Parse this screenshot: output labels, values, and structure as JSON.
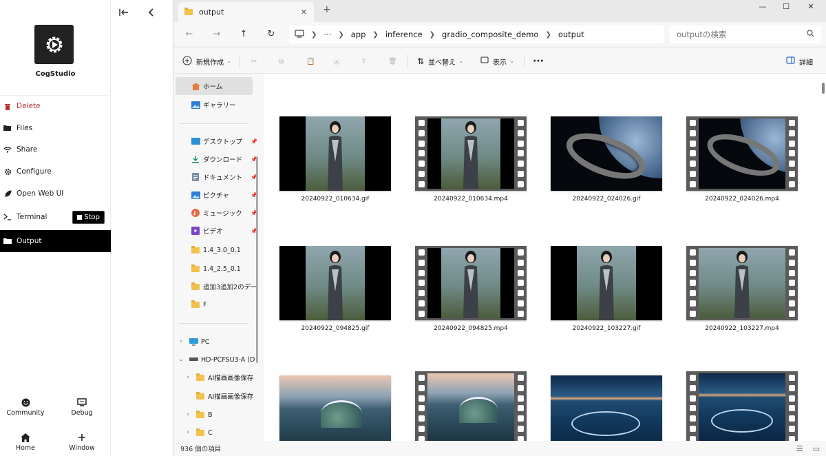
{
  "cogstudio": {
    "app_name": "CogStudio",
    "menu": [
      {
        "label": "Delete",
        "icon": "trash-icon"
      },
      {
        "label": "Files",
        "icon": "folder-open-icon"
      },
      {
        "label": "Share",
        "icon": "wifi-icon"
      },
      {
        "label": "Configure",
        "icon": "gear-icon"
      },
      {
        "label": "Open Web UI",
        "icon": "rocket-icon"
      },
      {
        "label": "Terminal",
        "icon": "terminal-icon"
      },
      {
        "label": "Output",
        "icon": "folder-icon"
      }
    ],
    "stop_label": "Stop",
    "active_item": "Output",
    "footer": [
      {
        "label": "Community",
        "icon": "smile-icon"
      },
      {
        "label": "Debug",
        "icon": "monitor-icon"
      },
      {
        "label": "Home",
        "icon": "home-icon"
      },
      {
        "label": "Window",
        "icon": "plus-icon"
      }
    ]
  },
  "explorer": {
    "tab_title": "output",
    "breadcrumb": [
      "app",
      "inference",
      "gradio_composite_demo",
      "output"
    ],
    "search_placeholder": "outputの検索",
    "toolbar": {
      "new_label": "新規作成",
      "sort_label": "並べ替え",
      "view_label": "表示",
      "details_label": "詳細"
    },
    "nav": {
      "home": "ホーム",
      "gallery": "ギャラリー",
      "pinned": [
        {
          "label": "デスクトップ",
          "icon": "desktop-icon"
        },
        {
          "label": "ダウンロード",
          "icon": "download-icon"
        },
        {
          "label": "ドキュメント",
          "icon": "document-icon"
        },
        {
          "label": "ピクチャ",
          "icon": "pictures-icon"
        },
        {
          "label": "ミュージック",
          "icon": "music-icon"
        },
        {
          "label": "ビデオ",
          "icon": "video-icon"
        }
      ],
      "folders": [
        "1.4_3.0_0.1",
        "1.4_2.5_0.1",
        "追加3追加2のデー",
        "F"
      ],
      "pc": "PC",
      "drive": "HD-PCFSU3-A (D",
      "drive_children": [
        "AI描画画像保存",
        "AI描画画像保存",
        "B",
        "C"
      ]
    },
    "files": [
      "20240922_010634.gif",
      "20240922_010634.mp4",
      "20240922_024026.gif",
      "20240922_024026.mp4",
      "20240922_094825.gif",
      "20240922_094825.mp4",
      "20240922_103227.gif",
      "20240922_103227.mp4"
    ],
    "status": "936 個の項目"
  }
}
